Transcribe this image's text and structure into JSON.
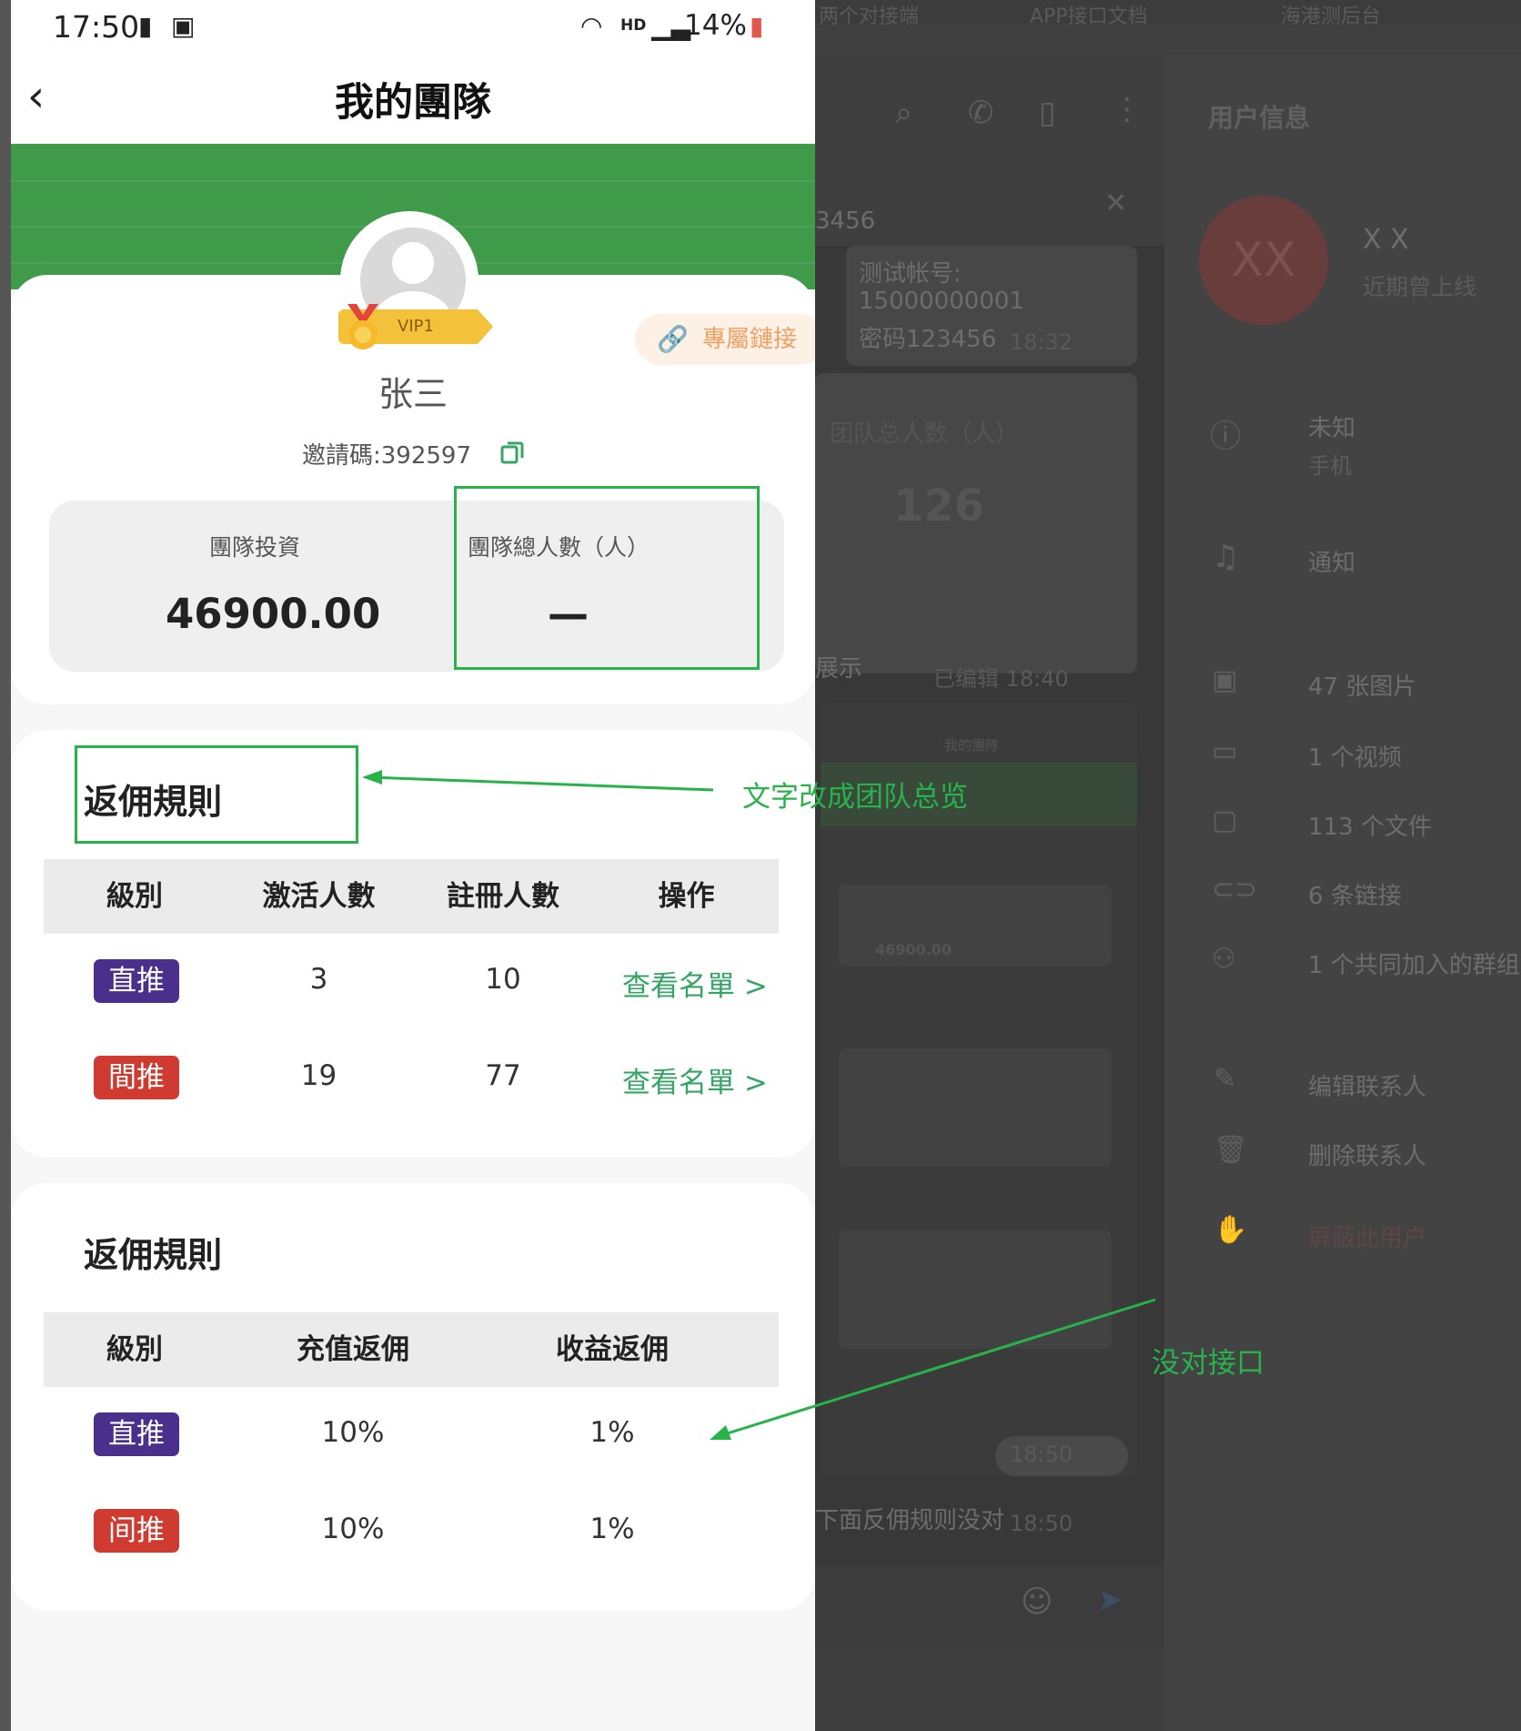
{
  "status_bar": {
    "time": "17:50",
    "network": "HD",
    "battery": "14%"
  },
  "header": {
    "title": "我的團隊"
  },
  "profile": {
    "vip_label": "VIP1",
    "name": "张三",
    "exclusive_link_label": "專屬鏈接",
    "invite_code": "邀請碼:392597"
  },
  "stats": {
    "investment_label": "團隊投資",
    "investment_value": "46900.00",
    "total_members_label": "團隊總人數（人）",
    "total_members_value": "—"
  },
  "team_table": {
    "title": "返佣規則",
    "headers": [
      "級別",
      "激活人數",
      "註冊人數",
      "操作"
    ],
    "rows": [
      {
        "level": "直推",
        "activated": "3",
        "registered": "10",
        "action": "查看名單 >",
        "color": "#4a2f8c"
      },
      {
        "level": "間推",
        "activated": "19",
        "registered": "77",
        "action": "查看名單 >",
        "color": "#cf3b30"
      }
    ]
  },
  "rebate_table": {
    "title": "返佣規則",
    "headers": [
      "級別",
      "充值返佣",
      "收益返佣"
    ],
    "rows": [
      {
        "level": "直推",
        "recharge": "10%",
        "earnings": "1%",
        "color": "#4a2f8c"
      },
      {
        "level": "间推",
        "recharge": "10%",
        "earnings": "1%",
        "color": "#cf3b30"
      }
    ]
  },
  "annotations": {
    "note_1": "文字改成团队总览",
    "note_2": "没对接口",
    "color": "#28b24a"
  },
  "background_window": {
    "tabs": [
      "两个对接端",
      "APP接口文档",
      "海港测后台"
    ],
    "chat_snippet_1": "3456",
    "chat_account": "测试帐号:",
    "chat_phone": "15000000001",
    "chat_password": "密码123456",
    "chat_time_1": "18:32",
    "chat_team_label": "团队总人数（人）",
    "chat_team_value": "126",
    "chat_show": "展示",
    "chat_edited": "已编辑 18:40",
    "chat_time_2": "18:50",
    "chat_last": "下面反佣规则没对",
    "chat_time_3": "18:50",
    "panel_title": "用户信息",
    "contact_initials": "XX",
    "contact_name": "X X",
    "contact_status": "近期曾上线",
    "info_unknown": "未知",
    "info_phone": "手机",
    "notify": "通知",
    "media": [
      "47 张图片",
      "1 个视频",
      "113 个文件",
      "6 条链接",
      "1 个共同加入的群组"
    ],
    "edit_contact": "编辑联系人",
    "delete_contact": "删除联系人",
    "block_user": "屏蔽此用户"
  }
}
